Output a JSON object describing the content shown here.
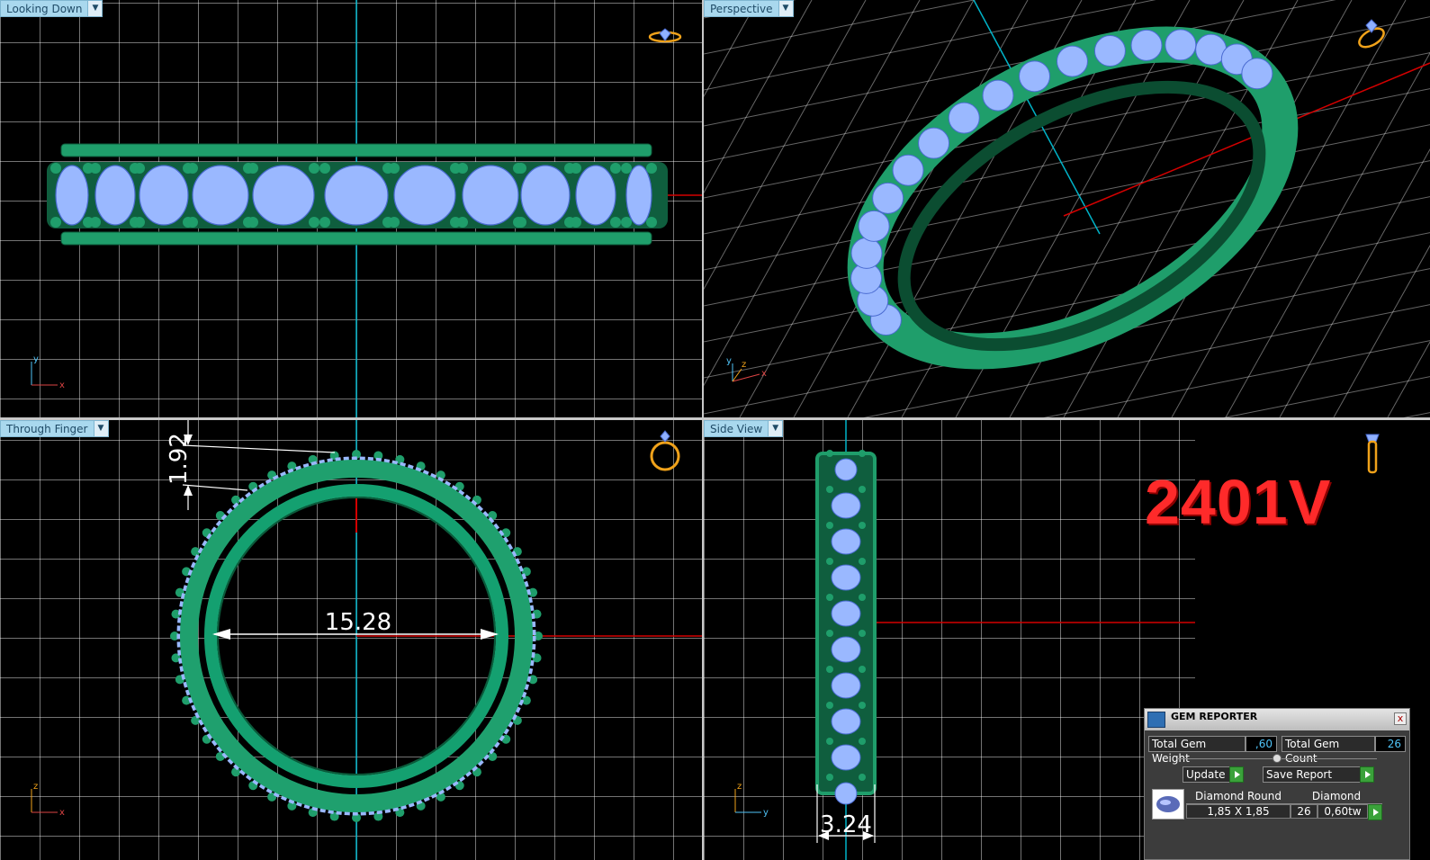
{
  "viewports": {
    "top_left": {
      "label": "Looking Down"
    },
    "top_right": {
      "label": "Perspective"
    },
    "bottom_left": {
      "label": "Through Finger"
    },
    "bottom_right": {
      "label": "Side View"
    }
  },
  "axes": {
    "looking_down": {
      "x": "x",
      "y": "y"
    },
    "perspective": {
      "x": "x",
      "y": "y",
      "z": "z"
    },
    "through_finger": {
      "x": "x",
      "z": "z"
    },
    "side_view": {
      "y": "y",
      "z": "z"
    }
  },
  "dimensions": {
    "gem_height": "1.92",
    "inner_diameter": "15.28",
    "band_width": "3.24"
  },
  "model_code": "2401V",
  "gem_reporter": {
    "title": "GEM REPORTER",
    "close_label": "x",
    "total_weight_label": "Total Gem Weight",
    "total_weight_value": ",60",
    "total_count_label": "Total Gem Count",
    "total_count_value": "26",
    "update_label": "Update",
    "save_report_label": "Save Report",
    "gem_row": {
      "shape": "Diamond Round",
      "size": "1,85 X 1,85",
      "material": "Diamond",
      "count": "26",
      "weight": "0,60tw"
    }
  },
  "icons": [
    "dropdown-arrow-icon",
    "ring-view-icon",
    "axis-gizmo-icon",
    "gem-reporter-icon",
    "close-icon",
    "go-arrow-icon"
  ],
  "colors": {
    "metal": "#1f9e6b",
    "gem": "#9ab8ff",
    "viewport_bg": "#000000",
    "label_bg": "#a9d8ee",
    "model_code": "#ff2a2a",
    "axis_red": "#d40000",
    "axis_cyan": "#00b3c8"
  }
}
